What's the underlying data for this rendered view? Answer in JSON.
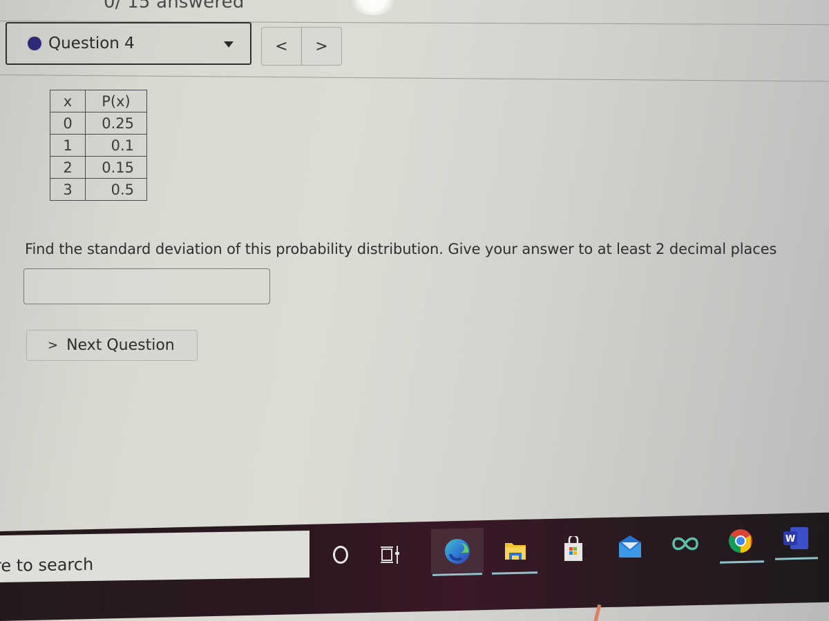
{
  "header": {
    "status_text": "0/ 15 answered",
    "question_selector": {
      "label": "Question 4",
      "status_dot_color": "#2d2a78",
      "dropdown_icon": "caret-down-icon"
    },
    "nav": {
      "prev_label": "<",
      "next_label": ">"
    }
  },
  "table": {
    "headers": [
      "x",
      "P(x)"
    ],
    "rows": [
      {
        "x": "0",
        "p": "0.25"
      },
      {
        "x": "1",
        "p": "0.1"
      },
      {
        "x": "2",
        "p": "0.15"
      },
      {
        "x": "3",
        "p": "0.5"
      }
    ]
  },
  "question": {
    "text": "Find the standard deviation of this probability distribution. Give your answer to at least 2 decimal places",
    "answer_value": "",
    "answer_placeholder": ""
  },
  "next_button": {
    "chevron": ">",
    "label": "Next Question"
  },
  "taskbar": {
    "search_text": "re to search",
    "apps": [
      {
        "name": "cortana",
        "icon": "cortana-circle-icon"
      },
      {
        "name": "task-view",
        "icon": "task-view-icon"
      },
      {
        "name": "edge",
        "icon": "edge-icon",
        "running": true,
        "active": true
      },
      {
        "name": "file-explorer",
        "icon": "folder-icon",
        "running": true
      },
      {
        "name": "microsoft-store",
        "icon": "store-bag-icon"
      },
      {
        "name": "mail",
        "icon": "mail-envelope-icon"
      },
      {
        "name": "infinity-app",
        "icon": "infinity-icon"
      },
      {
        "name": "chrome",
        "icon": "chrome-icon",
        "running": true
      },
      {
        "name": "word",
        "icon": "word-icon",
        "running": true,
        "letter": "W"
      }
    ],
    "underline_color": "#8fc4cc"
  }
}
